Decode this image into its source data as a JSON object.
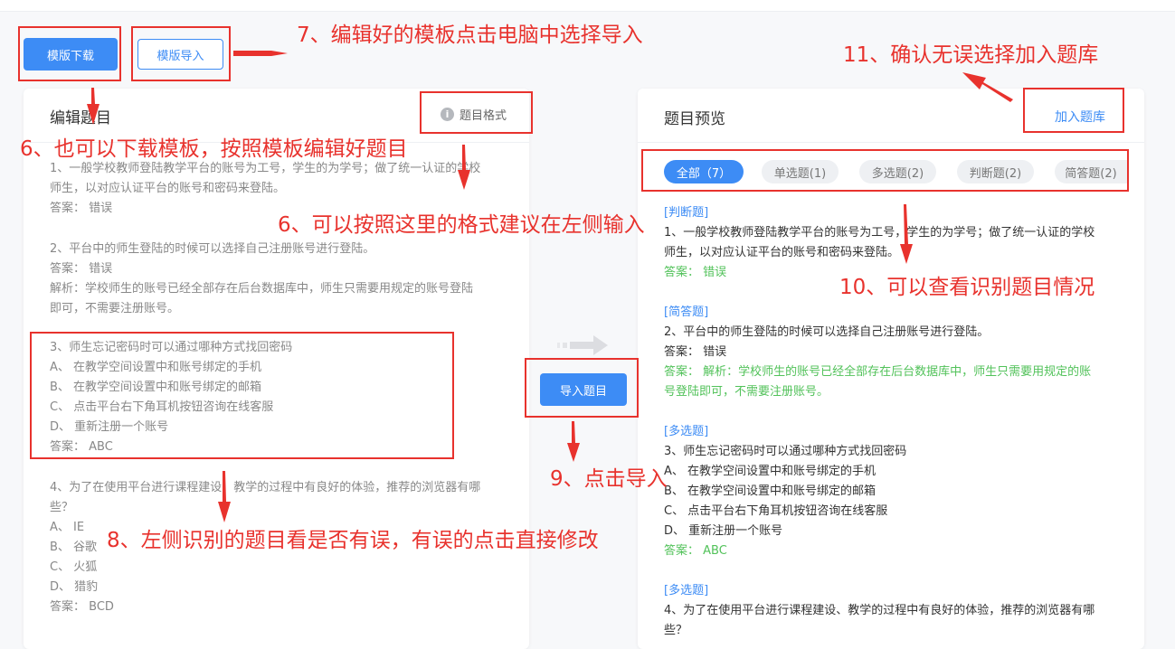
{
  "toolbar": {
    "download_label": "模版下载",
    "import_label": "模版导入"
  },
  "editor": {
    "title": "编辑题目",
    "format_label": "题目格式",
    "questions": [
      {
        "lines": [
          "1、一般学校教师登陆教学平台的账号为工号，学生的为学号；做了统一认证的学校",
          "师生，以对应认证平台的账号和密码来登陆。"
        ],
        "answer": "答案：  错误"
      },
      {
        "lines": [
          "2、平台中的师生登陆的时候可以选择自己注册账号进行登陆。"
        ],
        "answer": "答案：  错误",
        "analysis": [
          "解析：学校师生的账号已经全部存在后台数据库中，师生只需要用规定的账号登陆",
          "即可，不需要注册账号。"
        ]
      },
      {
        "lines": [
          "3、师生忘记密码时可以通过哪种方式找回密码",
          "A、 在教学空间设置中和账号绑定的手机",
          "B、 在教学空间设置中和账号绑定的邮箱",
          "C、 点击平台右下角耳机按钮咨询在线客服",
          "D、 重新注册一个账号"
        ],
        "answer": "答案：  ABC"
      },
      {
        "lines": [
          "4、为了在使用平台进行课程建设、教学的过程中有良好的体验，推荐的浏览器有哪",
          "些？",
          "A、 IE",
          "B、 谷歌",
          "C、 火狐",
          "D、 猎豹"
        ],
        "answer": "答案：  BCD"
      }
    ]
  },
  "import_button_label": "导入题目",
  "preview": {
    "title": "题目预览",
    "add_label": "加入题库",
    "tabs": [
      "全部（7）",
      "单选题(1)",
      "多选题(2)",
      "判断题(2)",
      "简答题(2)"
    ],
    "items": [
      {
        "tag": "[判断题]",
        "lines": [
          "1、一般学校教师登陆教学平台的账号为工号，学生的为学号；做了统一认证的学校",
          "师生，以对应认证平台的账号和密码来登陆。"
        ],
        "green": [
          "答案：  错误"
        ]
      },
      {
        "tag": "[简答题]",
        "lines": [
          "2、平台中的师生登陆的时候可以选择自己注册账号进行登陆。",
          "答案：  错误"
        ],
        "green": [
          "答案：  解析：学校师生的账号已经全部存在后台数据库中，师生只需要用规定的账",
          "号登陆即可，不需要注册账号。"
        ]
      },
      {
        "tag": "[多选题]",
        "lines": [
          "3、师生忘记密码时可以通过哪种方式找回密码",
          "A、 在教学空间设置中和账号绑定的手机",
          "B、 在教学空间设置中和账号绑定的邮箱",
          "C、 点击平台右下角耳机按钮咨询在线客服",
          "D、 重新注册一个账号"
        ],
        "green": [
          "答案：  ABC"
        ]
      },
      {
        "tag": "[多选题]",
        "lines": [
          "4、为了在使用平台进行课程建设、教学的过程中有良好的体验，推荐的浏览器有哪",
          "些？"
        ],
        "green": []
      }
    ]
  },
  "annotations": {
    "a7": "7、编辑好的模板点击电脑中选择导入",
    "a11": "11、确认无误选择加入题库",
    "a6a": "6、也可以下载模板，按照模板编辑好题目",
    "a6b": "6、可以按照这里的格式建议在左侧输入",
    "a10": "10、可以查看识别题目情况",
    "a9": "9、点击导入",
    "a8": "8、左侧识别的题目看是否有误，有误的点击直接修改"
  },
  "colors": {
    "accent": "#3d8cf5",
    "annotation": "#e8322d",
    "answer_green": "#52c25a"
  }
}
